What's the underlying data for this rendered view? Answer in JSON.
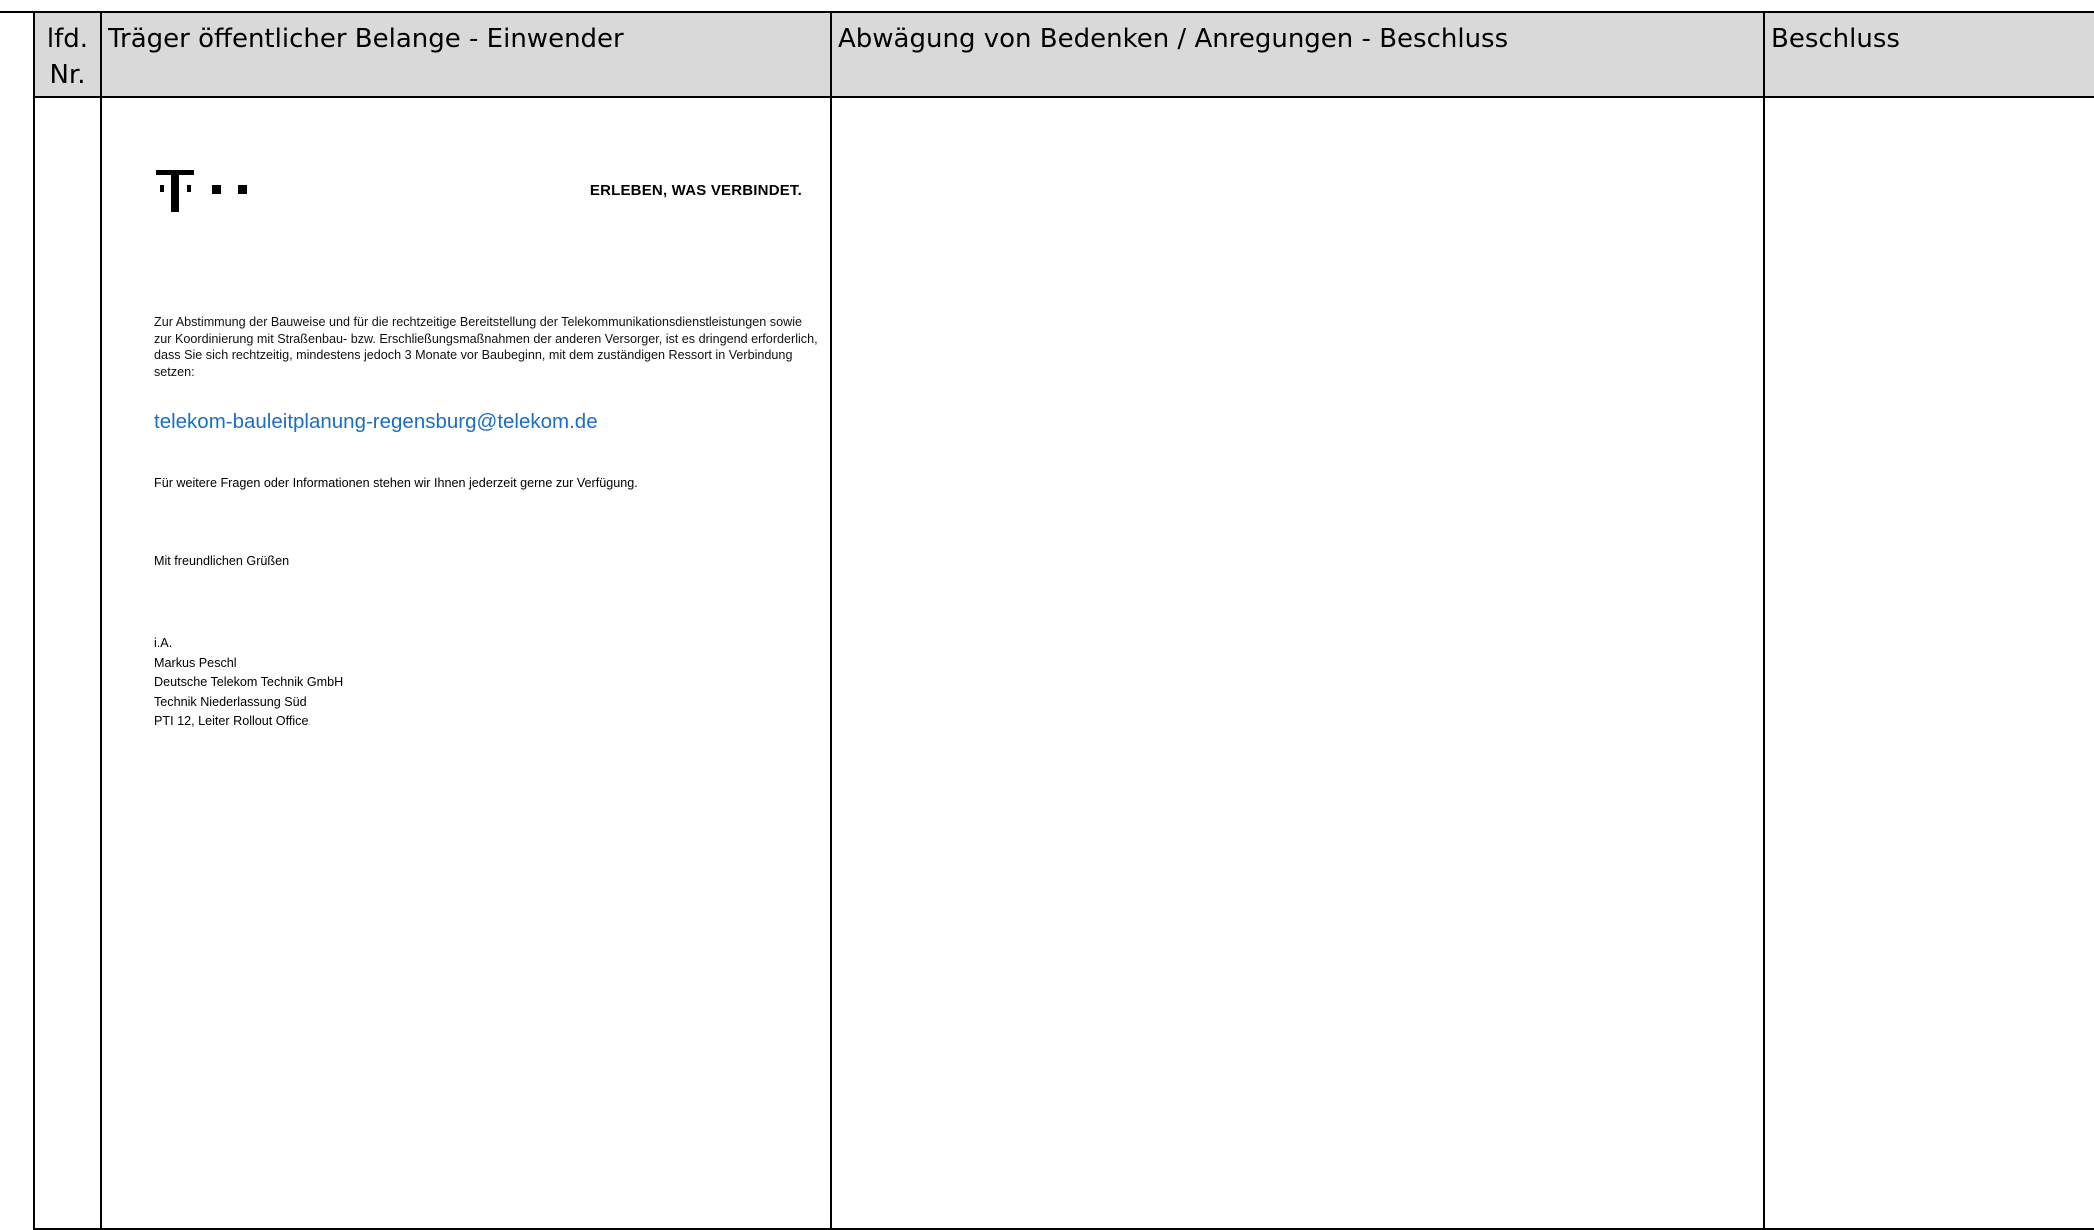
{
  "table": {
    "headers": {
      "nr": "lfd. Nr.",
      "einwender": "Träger öffentlicher Belange - Einwender",
      "abwaegung": "Abwägung von Bedenken / Anregungen - Beschluss",
      "beschluss": "Beschluss"
    }
  },
  "letter": {
    "logo_icon": "telekom-t-logo",
    "slogan": "ERLEBEN, WAS VERBINDET.",
    "body": "Zur Abstimmung der Bauweise und für die rechtzeitige Bereitstellung der Telekommunikationsdienstleistungen sowie zur Koordinierung mit Straßenbau- bzw. Erschließungsmaßnahmen der anderen Versorger, ist es dringend erforderlich, dass Sie sich rechtzeitig, mindestens jedoch 3 Monate vor Baubeginn, mit dem zuständigen Ressort in Verbindung setzen:",
    "email": "telekom-bauleitplanung-regensburg@telekom.de",
    "further": "Für weitere Fragen oder Informationen stehen wir Ihnen jederzeit gerne zur Verfügung.",
    "greeting": "Mit freundlichen Grüßen",
    "signature": [
      "i.A.",
      "Markus Peschl",
      "Deutsche Telekom Technik GmbH",
      "Technik Niederlassung Süd",
      "PTI 12, Leiter Rollout Office"
    ]
  },
  "colors": {
    "header_background": "#d9d9d9",
    "link": "#1a6fc4",
    "border": "#000000"
  }
}
